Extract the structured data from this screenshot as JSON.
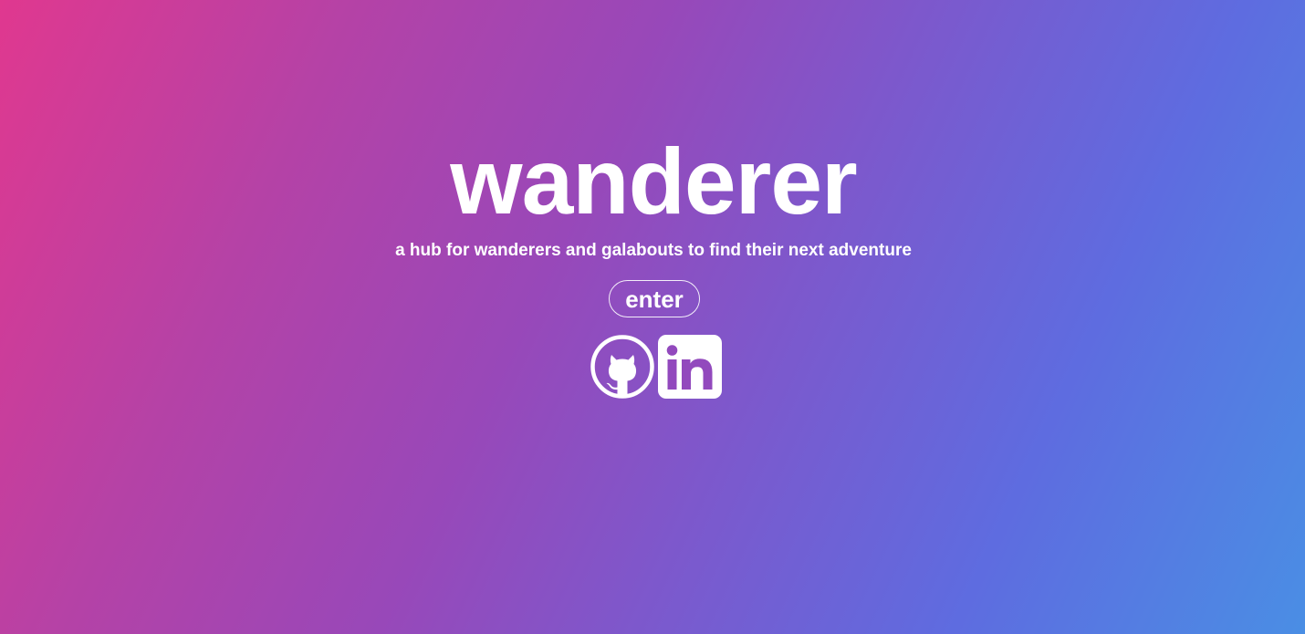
{
  "page": {
    "title": "wanderer",
    "tagline": "a hub for wanderers and galabouts to find their next adventure",
    "enter_label": "enter",
    "colors": {
      "gradient_start": "#e0388f",
      "gradient_mid": "#9848b9",
      "gradient_end": "#4a8ee4",
      "foreground": "#ffffff"
    }
  },
  "social_links": [
    {
      "icon": "github-icon"
    },
    {
      "icon": "linkedin-icon"
    }
  ]
}
